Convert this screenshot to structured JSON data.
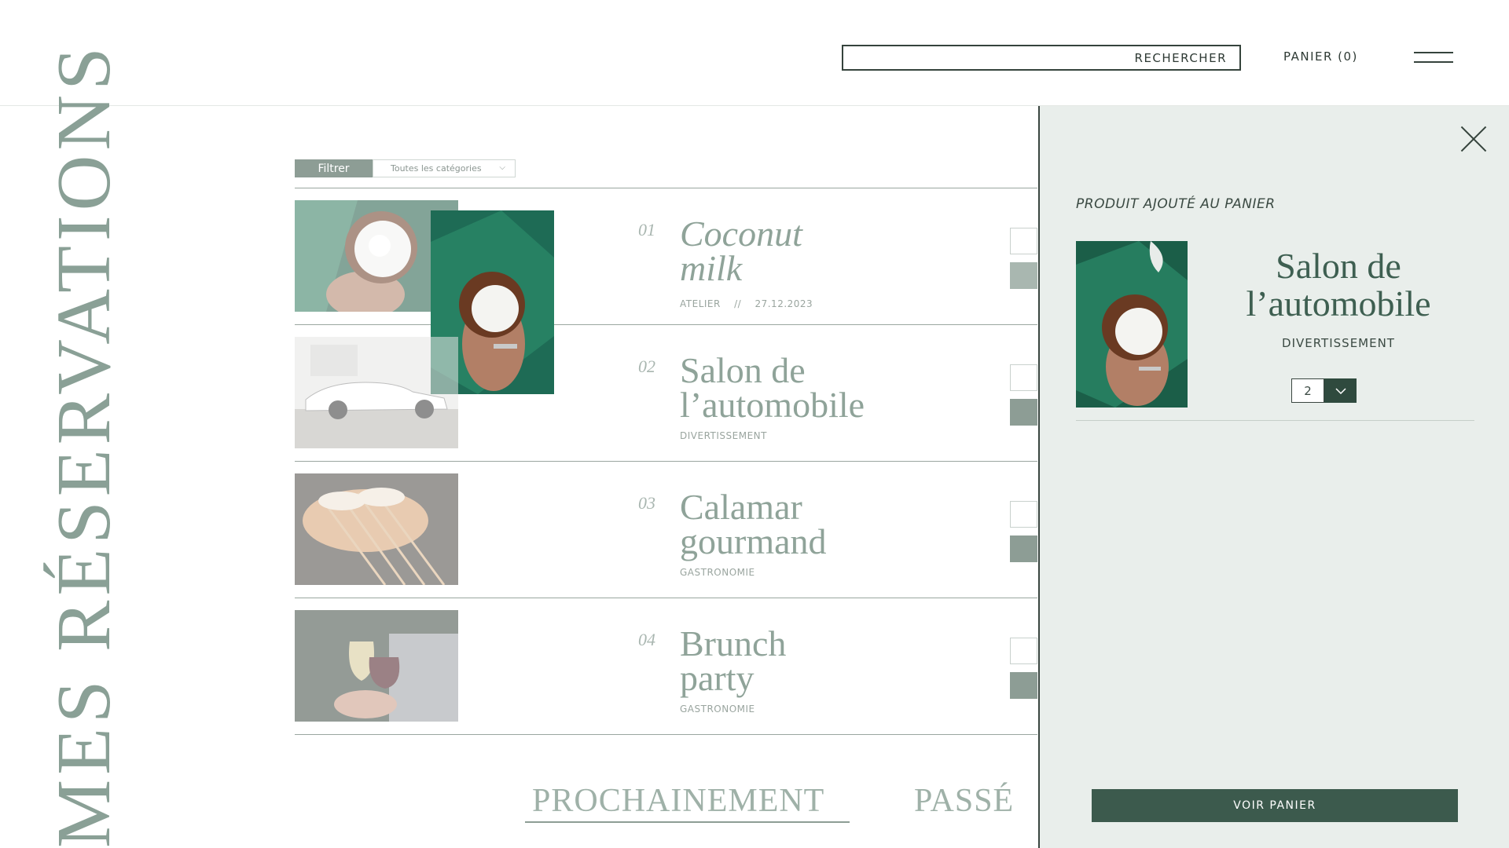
{
  "header": {
    "search_label": "RECHERCHER",
    "cart_label": "PANIER (0)",
    "menu_icon": "hamburger-icon"
  },
  "page": {
    "vertical_title": "MES RÉSERVATIONS"
  },
  "filter": {
    "button_label": "Filtrer",
    "select_value": "Toutes les catégories"
  },
  "reservations": [
    {
      "num": "01",
      "title_line1": "Coconut",
      "title_line2": "milk",
      "category": "ATELIER",
      "date": "27.12.2023",
      "image": "coconut-photo"
    },
    {
      "num": "02",
      "title_line1": "Salon de",
      "title_line2": "l’automobile",
      "category": "DIVERTISSEMENT",
      "image": "car-photo"
    },
    {
      "num": "03",
      "title_line1": "Calamar",
      "title_line2": "gourmand",
      "category": "GASTRONOMIE",
      "image": "squid-skewers-photo"
    },
    {
      "num": "04",
      "title_line1": "Brunch",
      "title_line2": "party",
      "category": "GASTRONOMIE",
      "image": "wine-glasses-photo"
    }
  ],
  "meta_separator": "//",
  "tabs": {
    "upcoming": "PROCHAINEMENT",
    "past": "PASSÉ"
  },
  "panel": {
    "heading": "PRODUIT AJOUTÉ AU PANIER",
    "product_title_line1": "Salon de",
    "product_title_line2": "l’automobile",
    "product_category": "DIVERTISSEMENT",
    "quantity": "2",
    "view_cart_label": "VOIR PANIER",
    "image": "coconut-photo"
  },
  "colors": {
    "accent_dark": "#3c5a4d",
    "panel_bg": "#e9eeeb",
    "muted_green": "#8d9d95"
  }
}
